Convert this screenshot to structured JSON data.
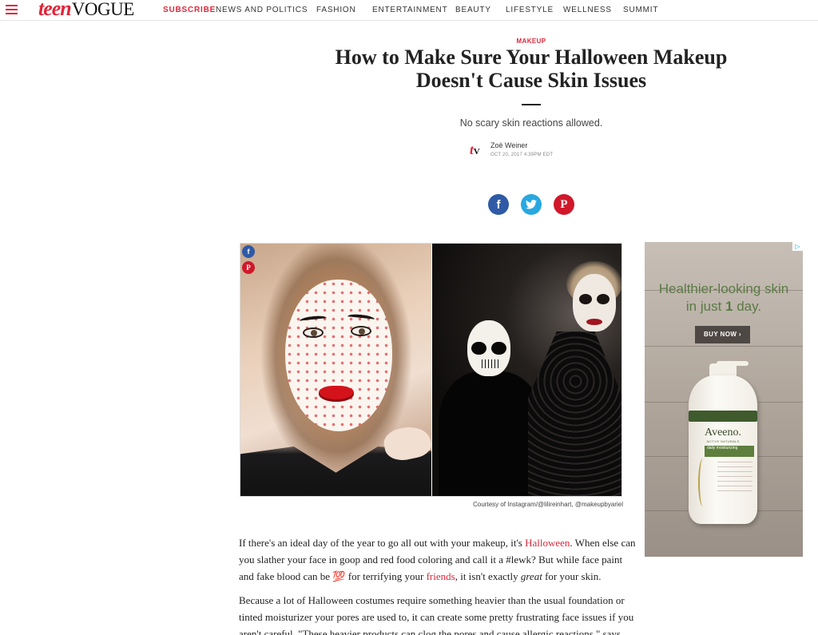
{
  "nav": {
    "logo_teen": "teen",
    "logo_vogue": "VOGUE",
    "subscribe": "SUBSCRIBE",
    "links": [
      "NEWS AND POLITICS",
      "FASHION",
      "ENTERTAINMENT",
      "BEAUTY",
      "LIFESTYLE",
      "WELLNESS",
      "SUMMIT"
    ]
  },
  "article": {
    "rubric": "MAKEUP",
    "headline": "How to Make Sure Your Halloween Makeup Doesn't Cause Skin Issues",
    "dek": "No scary skin reactions allowed.",
    "author": "Zoë Weiner",
    "date": "OCT 20, 2017 4:39PM EDT",
    "image_credit": "Courtesy of Instagram/@lilireinhart, @makeupbyariel",
    "p1_a": "If there's an ideal day of the year to go all out with your makeup, it's ",
    "p1_link1": "Halloween",
    "p1_b": ". When else can you slather your face in goop and red food coloring and call it a #lewk? But while face paint and fake blood can be ",
    "p1_emoji": "💯",
    "p1_c": " for terrifying your ",
    "p1_link2": "friends",
    "p1_d": ", it isn't exactly ",
    "p1_em": "great",
    "p1_e": " for your skin.",
    "p2": "Because a lot of Halloween costumes require something heavier than the usual foundation or tinted moisturizer your pores are used to, it can create some pretty frustrating face issues if you aren't careful. \"These heavier products can clog the pores and cause allergic reactions,\" says"
  },
  "ad": {
    "headline_a": "Healthier-looking skin",
    "headline_b": "in just ",
    "headline_num": "1",
    "headline_c": " day.",
    "button": "BUY NOW ›",
    "brand": "Aveeno.",
    "brand_sub": "ACTIVE NATURALS",
    "band_text": "daily moisturizing",
    "adchoice": "▷"
  },
  "colors": {
    "brand_red": "#e0263a",
    "facebook": "#2f5aa6",
    "twitter": "#29a8e0",
    "pinterest": "#d0182a",
    "ad_green": "#5b7a45"
  }
}
